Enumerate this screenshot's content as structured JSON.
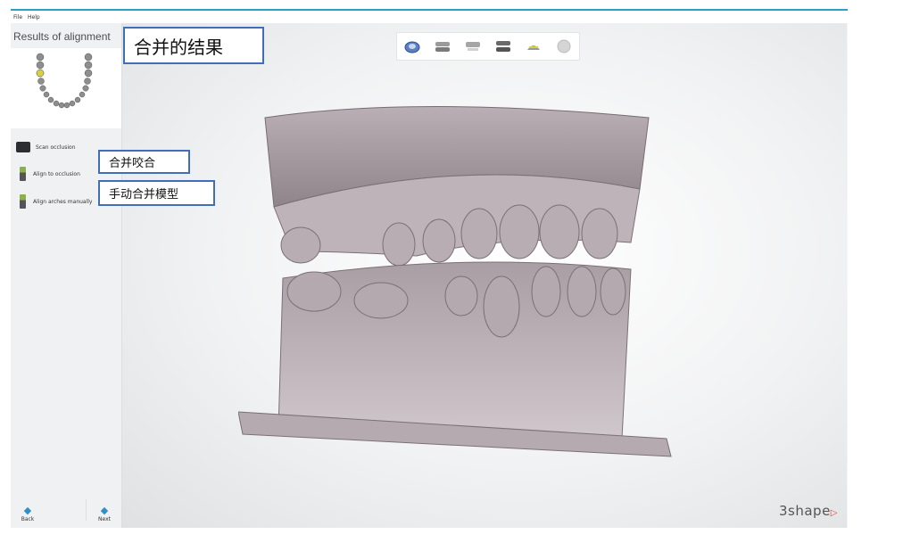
{
  "menu": {
    "file": "File",
    "help": "Help"
  },
  "sidebar": {
    "title": "Results of alignment",
    "steps": [
      {
        "label": "Scan occlusion"
      },
      {
        "label": "Align to occlusion"
      },
      {
        "label": "Align arches manually"
      }
    ],
    "back_label": "Back",
    "next_label": "Next"
  },
  "callouts": {
    "title": "合并的结果",
    "occlusion": "合并咬合",
    "manual": "手动合并模型"
  },
  "brand": {
    "name": "3shape",
    "accent": "#e0403a"
  },
  "toolbar": {
    "icons": [
      "upper-jaw-icon",
      "both-jaws-icon",
      "lower-jaw-icon",
      "occlusion-icon",
      "bite-icon",
      "sphere-icon"
    ]
  },
  "colors": {
    "accent": "#2aa0c8",
    "callout_border": "#3f6fb8",
    "model": "#a99ea4"
  }
}
